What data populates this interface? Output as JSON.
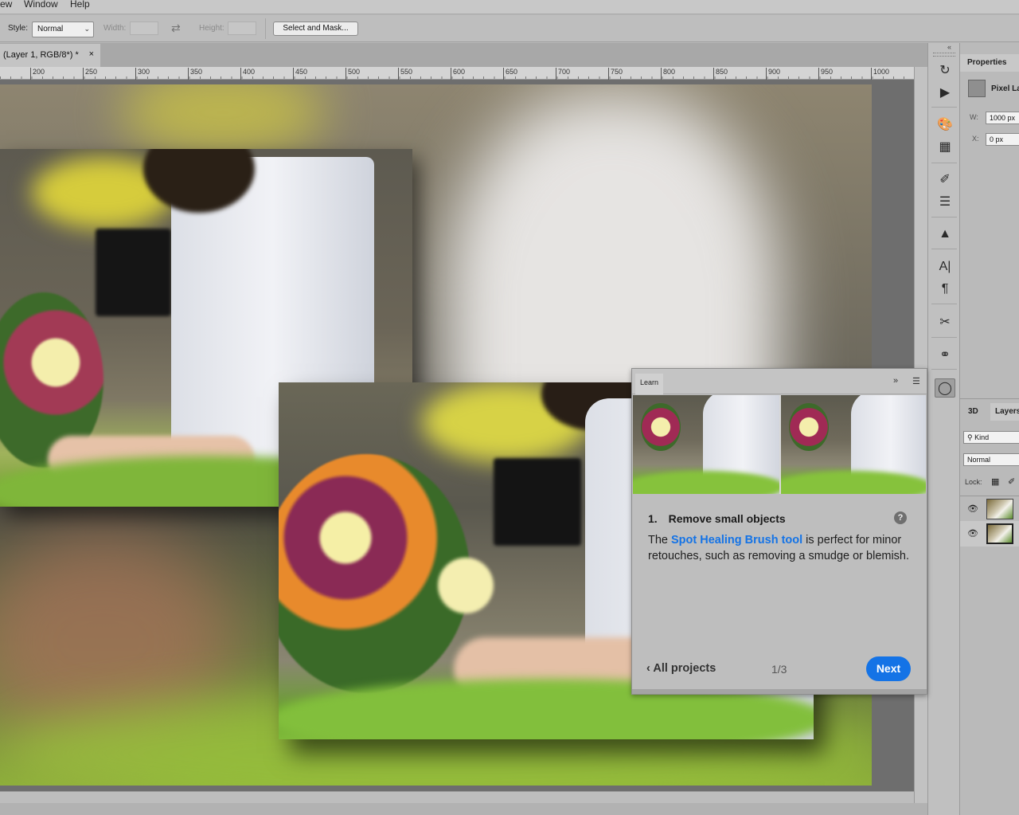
{
  "menubar": {
    "items": [
      "ew",
      "Window",
      "Help"
    ]
  },
  "options": {
    "style_label": "Style:",
    "style_value": "Normal",
    "width_label": "Width:",
    "height_label": "Height:",
    "select_mask_label": "Select and Mask..."
  },
  "document": {
    "tab_title": "(Layer 1, RGB/8*) *",
    "close_glyph": "×"
  },
  "ruler": {
    "ticks": [
      "200",
      "250",
      "300",
      "350",
      "400",
      "450",
      "500",
      "550",
      "600",
      "650",
      "700",
      "750",
      "800",
      "850",
      "900",
      "950",
      "1000"
    ]
  },
  "properties": {
    "tab_label": "Properties",
    "layer_type": "Pixel La",
    "w_label": "W:",
    "w_value": "1000 px",
    "x_label": "X:",
    "x_value": "0 px"
  },
  "layers": {
    "tab_3d": "3D",
    "tab_layers": "Layers",
    "filter_kind": "Kind",
    "blend_mode": "Normal",
    "lock_label": "Lock:"
  },
  "learn": {
    "tab_label": "Learn",
    "step_number": "1.",
    "step_title": "Remove small objects",
    "body_before": "The ",
    "body_link": "Spot Healing Brush tool",
    "body_after": " is perfect for minor retouches, such as removing a smudge or blemish.",
    "all_projects": "All projects",
    "pager": "1/3",
    "next_label": "Next",
    "help_glyph": "?"
  },
  "colors": {
    "accent": "#1473e6",
    "panel_bg": "#bebebe",
    "workspace_bg": "#6e6e6e"
  }
}
